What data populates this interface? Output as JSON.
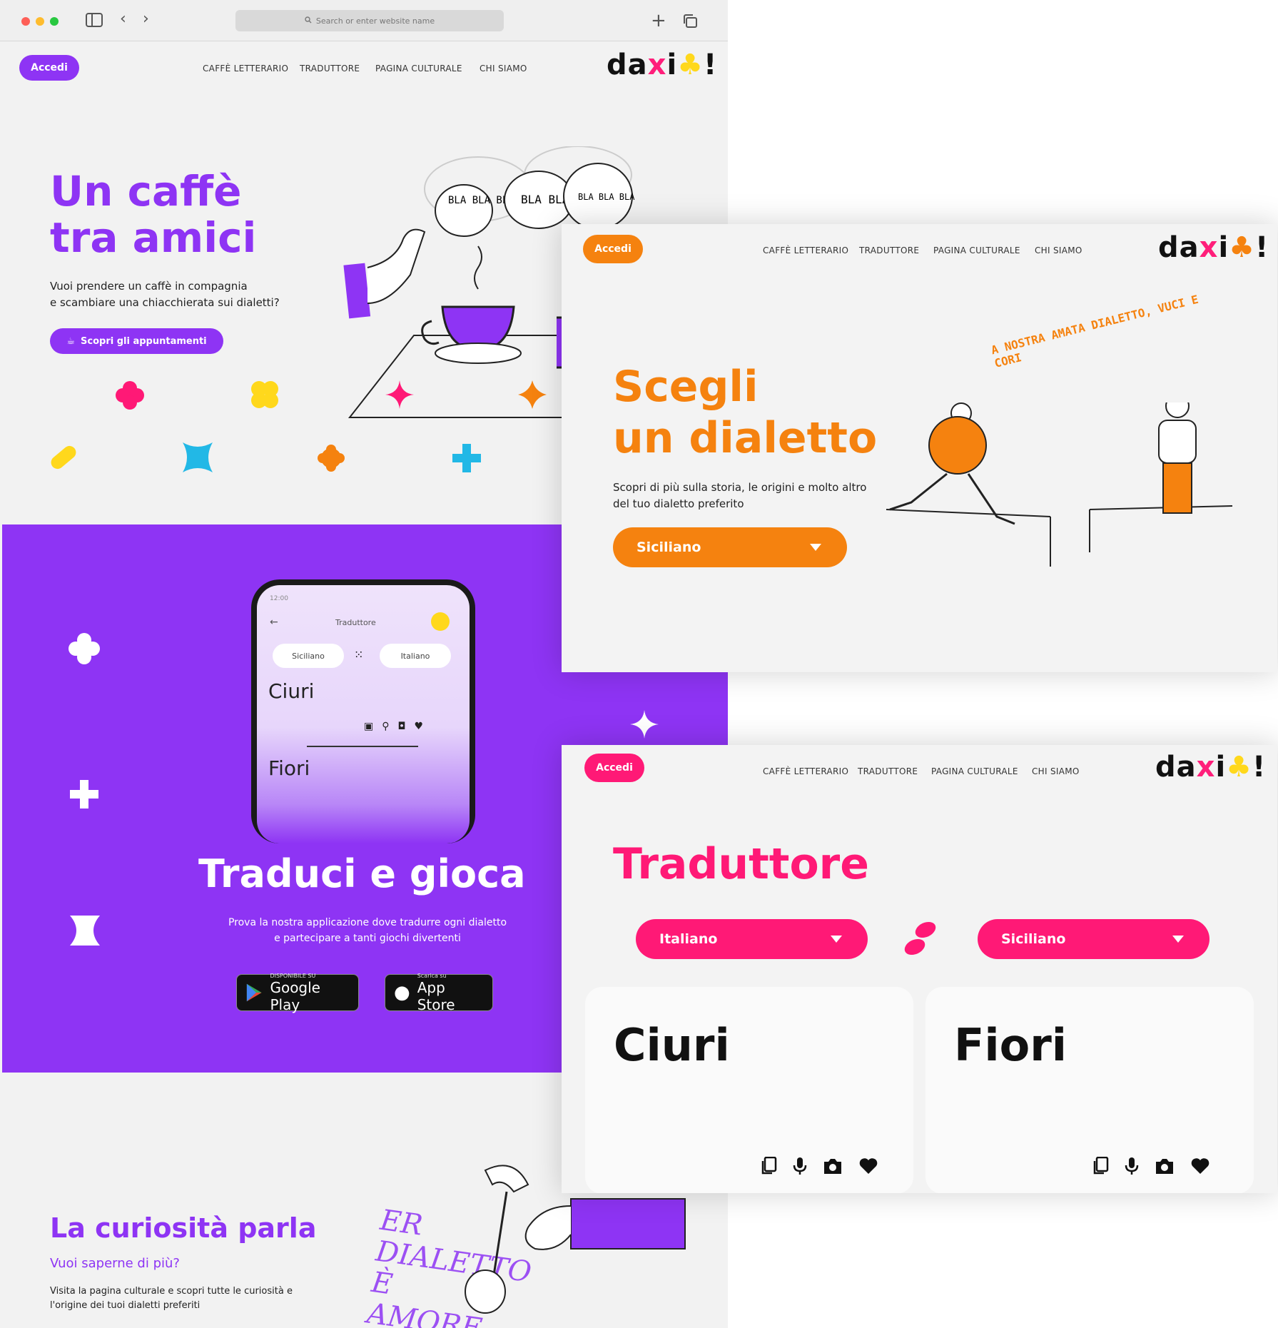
{
  "browser": {
    "address_placeholder": "Search or enter website name"
  },
  "nav": {
    "login": "Accedi",
    "links": [
      "CAFFÈ LETTERARIO",
      "TRADUTTORE",
      "PAGINA CULTURALE",
      "CHI SIAMO"
    ],
    "logo": {
      "a": "da",
      "b": "x",
      "c": "i",
      "d": "♣",
      "e": "!"
    }
  },
  "home": {
    "hero": {
      "title_line1": "Un caffè",
      "title_line2": "tra amici",
      "text_line1": "Vuoi prendere un caffè in compagnia",
      "text_line2": "e scambiare una chiacchierata sui dialetti?",
      "cta": "Scopri gli appuntamenti",
      "bubbles": [
        "BLA BLA BLA",
        "BLA BLA!",
        "BLA BLA BLA"
      ]
    },
    "app": {
      "phone_time": "12:00",
      "phone_title": "Traduttore",
      "phone_from": "Siciliano",
      "phone_to": "Italiano",
      "phone_source": "Ciuri",
      "phone_target": "Fiori",
      "title": "Traduci e gioca",
      "text_line1": "Prova la nostra applicazione dove tradurre ogni dialetto",
      "text_line2": "e partecipare a tanti giochi divertenti",
      "google_small": "DISPONIBILE SU",
      "google_big": "Google Play",
      "apple_small": "Scarica su",
      "apple_big": "App Store"
    },
    "curiosity": {
      "title": "La curiosità parla",
      "subtitle": "Vuoi saperne di più?",
      "text_line1": "Visita la pagina culturale e scopri tutte le curiosità e",
      "text_line2": "l'origine dei tuoi dialetti preferiti",
      "lettering": "ER DIALETTO È AMORE PE..."
    }
  },
  "dialect_page": {
    "title_line1": "Scegli",
    "title_line2": "un dialetto",
    "text_line1": "Scopri di più sulla storia, le origini e molto altro",
    "text_line2": "del tuo dialetto preferito",
    "select_value": "Siciliano",
    "lettering": "A NOSTRA AMATA DIALETTO, VUCI E CORI"
  },
  "translator_page": {
    "title": "Traduttore",
    "from_value": "Italiano",
    "to_value": "Siciliano",
    "source_word": "Ciuri",
    "target_word": "Fiori"
  },
  "colors": {
    "purple": "#8e34f4",
    "orange": "#f5820f",
    "pink": "#ff1976",
    "yellow": "#ffd81c",
    "cyan": "#22b8e6"
  },
  "icons": [
    "sidebar-icon",
    "back-icon",
    "forward-icon",
    "plus-icon",
    "tabs-icon",
    "search-icon",
    "copy-icon",
    "mic-icon",
    "camera-icon",
    "heart-icon",
    "swap-icon",
    "coffee-icon"
  ]
}
